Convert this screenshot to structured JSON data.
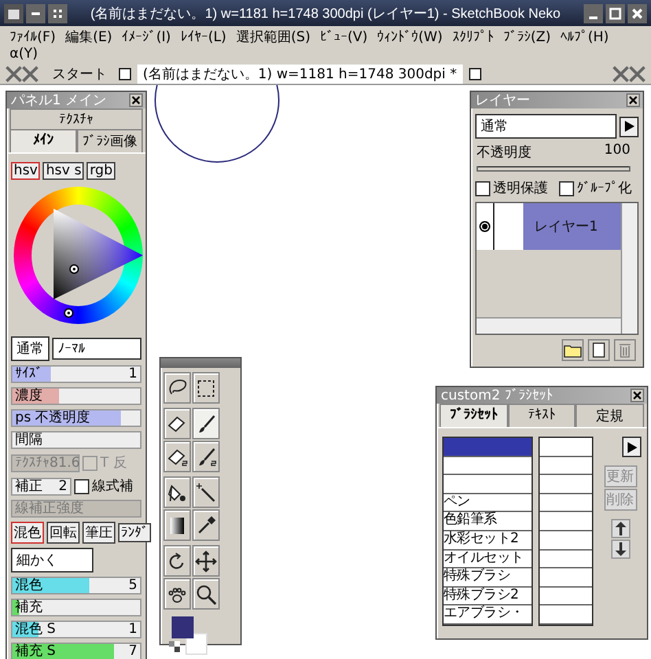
{
  "window": {
    "title": "(名前はまだない。1) w=1181 h=1748 300dpi  (レイヤー1) - SketchBook Neko"
  },
  "menu": [
    "ﾌｧｲﾙ(F)",
    "編集(E)",
    "ｲﾒｰｼﾞ(I)",
    "ﾚｲﾔｰ(L)",
    "選択範囲(S)",
    "ﾋﾞｭｰ(V)",
    "ｳｨﾝﾄﾞｳ(W)",
    "ｽｸﾘﾌﾟﾄ",
    "ﾌﾞﾗｼ(Z)",
    "ﾍﾙﾌﾟ(H)",
    "α(Y)"
  ],
  "doc_tabs": [
    {
      "label": "スタート",
      "selected": false
    },
    {
      "label": "(名前はまだない。1) w=1181 h=1748 300dpi *",
      "selected": true
    }
  ],
  "main_panel": {
    "title": "パネル1 メイン",
    "tabs_top": [
      {
        "label": "ﾃｸｽﾁｬ",
        "selected": false
      }
    ],
    "tabs": [
      {
        "label": "ﾒｲﾝ",
        "selected": true
      },
      {
        "label": "ﾌﾞﾗｼ画像",
        "selected": false
      }
    ],
    "color_modes": [
      {
        "label": "hsv",
        "selected": true
      },
      {
        "label": "hsv s",
        "selected": false
      },
      {
        "label": "rgb",
        "selected": false
      }
    ],
    "blend_mode": "通常",
    "blend_mode_2": "ﾉｰﾏﾙ",
    "controls": [
      {
        "kind": "slider",
        "label": "ｻｲｽﾞ",
        "level": 0.3,
        "value": "1",
        "color": "#b4b8f0",
        "disabled": false
      },
      {
        "kind": "slider",
        "label": "濃度",
        "level": 0.37,
        "color": "#e2aca8",
        "disabled": false
      },
      {
        "kind": "slider",
        "label": "ps 不透明度",
        "level": 0.85,
        "color": "#b4b8f0",
        "disabled": false
      },
      {
        "kind": "slider",
        "label": "間隔",
        "disabled": false
      },
      {
        "kind": "slider_check",
        "label": "ﾃｸｽﾁｬ",
        "value": "81.6",
        "check_label": "T 反",
        "checked": false,
        "disabled": true
      },
      {
        "kind": "slider_check",
        "label": "補正",
        "value": "2",
        "check_label": "線式補",
        "checked": false,
        "disabled": false
      },
      {
        "kind": "slider",
        "label": "線補正強度",
        "disabled": true
      }
    ],
    "mix_tabs": [
      {
        "label": "混色",
        "selected": true
      },
      {
        "label": "回転",
        "selected": false
      },
      {
        "label": "筆圧",
        "selected": false
      },
      {
        "label": "ﾗﾝﾀﾞ",
        "selected": false
      }
    ],
    "mix_mode": "細かく",
    "mix_sliders": [
      {
        "label": "混色",
        "level": 0.6,
        "value": "5",
        "color": "#66dde8"
      },
      {
        "label": "補充",
        "level": 0.05,
        "color": "#66dd66"
      },
      {
        "label": "混色 S",
        "level": 0.2,
        "value": "1",
        "color": "#66dde8"
      },
      {
        "label": "補充 S",
        "level": 0.8,
        "value": "7",
        "color": "#66dd66"
      }
    ]
  },
  "layer_panel": {
    "title": "レイヤー",
    "blend_mode": "通常",
    "opacity_label": "不透明度",
    "opacity_value": "100",
    "level": 1,
    "options": [
      {
        "label": "透明保護",
        "checked": false
      },
      {
        "label": "ｸﾞﾙｰﾌﾟ化",
        "checked": false
      }
    ],
    "layers": [
      {
        "name": "レイヤー1",
        "visible": true,
        "selected": true
      }
    ]
  },
  "tool_palette": {
    "groups": [
      [
        {
          "kind": "lasso",
          "selected": false
        },
        {
          "kind": "rect_select",
          "selected": false
        }
      ],
      [
        {
          "kind": "eraser",
          "selected": false
        },
        {
          "kind": "brush",
          "selected": true
        },
        {
          "kind": "eraser_s",
          "selected": false
        },
        {
          "kind": "brush_s",
          "selected": false
        }
      ],
      [
        {
          "kind": "fill",
          "selected": false
        },
        {
          "kind": "wand",
          "selected": false
        },
        {
          "kind": "gradient",
          "selected": false
        },
        {
          "kind": "dropper",
          "selected": false
        }
      ],
      [
        {
          "kind": "rotate",
          "selected": false
        },
        {
          "kind": "move",
          "selected": false
        },
        {
          "kind": "hand",
          "selected": false
        },
        {
          "kind": "zoom",
          "selected": false
        }
      ]
    ],
    "swatches": [
      {
        "kind": "background",
        "color": "#ffffff"
      },
      {
        "kind": "foreground",
        "color": "#332f78"
      }
    ]
  },
  "brush_panel": {
    "title": "custom2 ﾌﾞﾗｼｾｯﾄ",
    "tabs": [
      {
        "label": "ﾌﾞﾗｼｾｯﾄ",
        "selected": true
      },
      {
        "label": "ﾃｷｽﾄ",
        "selected": false
      },
      {
        "label": "定規",
        "selected": false
      }
    ],
    "sets": [
      {
        "selected": true
      },
      {
        "selected": false
      },
      {
        "selected": false
      },
      {
        "label": "ペン",
        "selected": false
      },
      {
        "label": "色鉛筆系",
        "selected": false
      },
      {
        "label": "水彩セット2",
        "selected": false
      },
      {
        "label": "オイルセット",
        "selected": false
      },
      {
        "label": "特殊ブラシ",
        "selected": false
      },
      {
        "label": "特殊ブラシ2",
        "selected": false
      },
      {
        "label": "エアブラシ・",
        "selected": false
      }
    ],
    "buttons": [
      {
        "label": "更新",
        "disabled": true
      },
      {
        "label": "削除",
        "disabled": true
      }
    ]
  }
}
